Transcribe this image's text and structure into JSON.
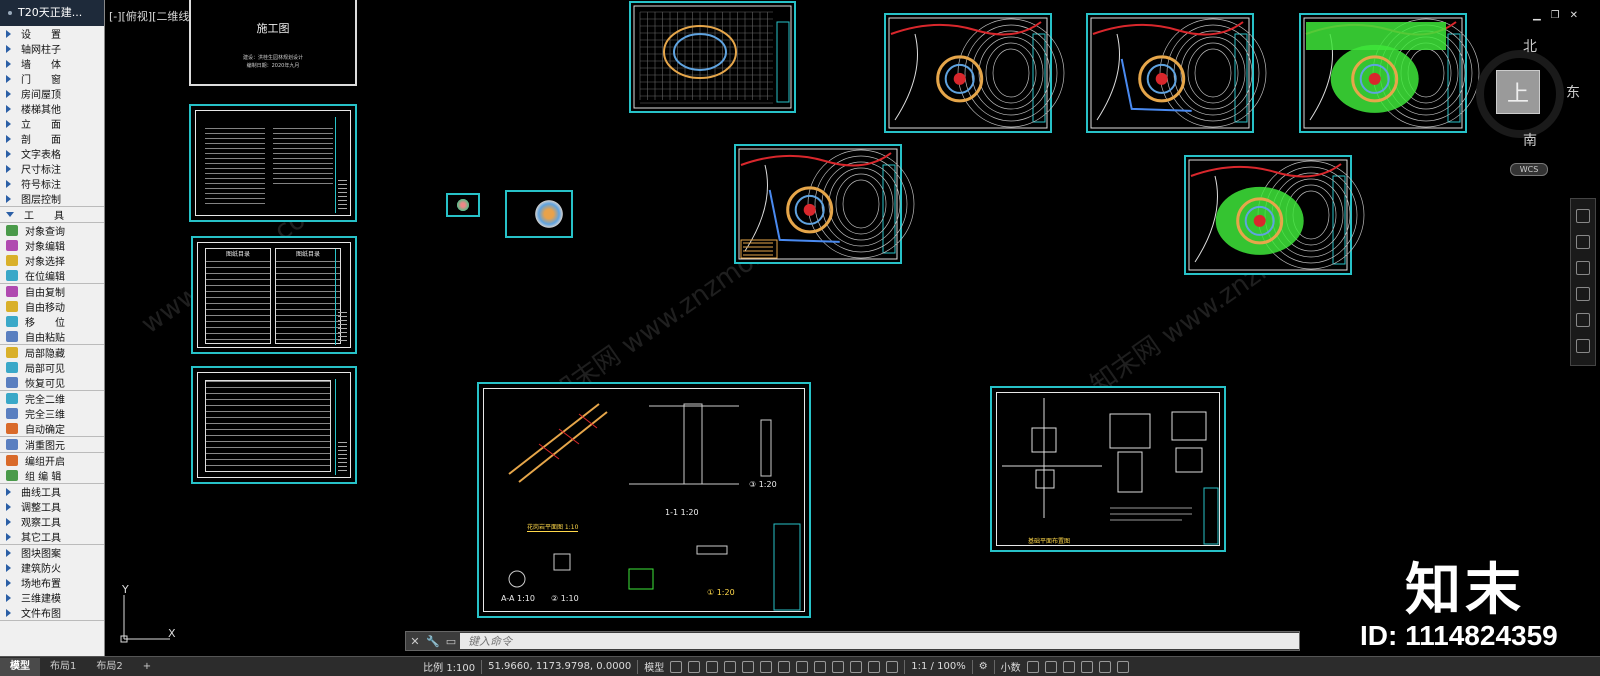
{
  "palette": {
    "title": "T20天正建...",
    "groups": [
      {
        "items": [
          "设　　置",
          "轴网柱子",
          "墙　　体",
          "门　　窗",
          "房间屋顶",
          "楼梯其他",
          "立　　面",
          "剖　　面",
          "文字表格",
          "尺寸标注",
          "符号标注",
          "图层控制"
        ]
      },
      {
        "items": [
          "工　　具"
        ]
      },
      {
        "items": [
          "对象查询",
          "对象编辑",
          "对象选择",
          "在位编辑"
        ]
      },
      {
        "items": [
          "自由复制",
          "自由移动",
          "移　　位",
          "自由粘贴"
        ]
      },
      {
        "items": [
          "局部隐藏",
          "局部可见",
          "恢复可见"
        ]
      },
      {
        "items": [
          "完全二维",
          "完全三维",
          "自动确定"
        ]
      },
      {
        "items": [
          "消重图元"
        ]
      },
      {
        "items": [
          "编组开启",
          "组 编 辑"
        ]
      },
      {
        "items": [
          "曲线工具",
          "调整工具",
          "观察工具",
          "其它工具"
        ]
      },
      {
        "items": [
          "图块图案",
          "建筑防火",
          "场地布置",
          "三维建模",
          "文件布图"
        ]
      }
    ]
  },
  "viewport": {
    "label": "[-][俯视][二维线框]",
    "cover_sheet_title": "施工图",
    "cover_sheet_sub1": "建设：洪桂生园林规划设计",
    "cover_sheet_sub2": "编制日期：2020年九月",
    "index_title_left": "图纸目录",
    "index_title_right": "图纸目录",
    "detail_label_1": "1-1 1:20",
    "detail_label_2": "③ 1:20",
    "detail_label_3": "A-A 1:10",
    "detail_label_4": "② 1:10",
    "detail_label_5": "① 1:20",
    "detail_label_6": "花岗岩平面图 1:10",
    "plan_label": "基础平面布置图",
    "watermark": "znzmo.com  www.znzmo.com  知末网"
  },
  "viewcube": {
    "north": "北",
    "east": "东",
    "south": "南",
    "face": "上",
    "wcs": "WCS"
  },
  "ucs": {
    "x": "X",
    "y": "Y"
  },
  "command": {
    "placeholder": "键入命令"
  },
  "status": {
    "tabs": [
      "模型",
      "布局1",
      "布局2",
      "+"
    ],
    "scale": "比例 1:100",
    "coords": "51.9660, 1173.9798, 0.0000",
    "mode": "模型",
    "annoscale": "1:1 / 100%",
    "units": "小数"
  },
  "brand": {
    "name": "知末",
    "id": "ID: 1114824359"
  },
  "colors": {
    "sheet_border": "#27c2c8",
    "accent_green": "#3ee63a",
    "road_red": "#d9272c"
  }
}
